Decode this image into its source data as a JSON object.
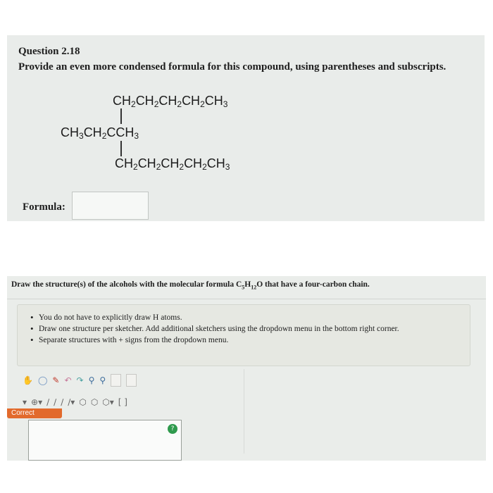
{
  "question": {
    "title": "Question 2.18",
    "prompt": "Provide an even more condensed formula for this compound, using parentheses and subscripts.",
    "structure": {
      "top_chain": [
        "CH",
        "2",
        "CH",
        "2",
        "CH",
        "2",
        "CH",
        "2",
        "CH",
        "3"
      ],
      "middle_chain": [
        "CH",
        "3",
        "CH",
        "2",
        "CCH",
        "3"
      ],
      "bottom_chain": [
        "CH",
        "2",
        "CH",
        "2",
        "CH",
        "2",
        "CH",
        "2",
        "CH",
        "3"
      ]
    },
    "formula_label": "Formula:",
    "formula_value": ""
  },
  "sketcher": {
    "title_parts": [
      "Draw the structure(s) of the alcohols with the molecular formula C",
      "5",
      "H",
      "12",
      "O that have a four-carbon chain."
    ],
    "instructions": [
      "You do not have to explicitly draw H atoms.",
      "Draw one structure per sketcher. Add additional sketchers using the dropdown menu in the bottom right corner.",
      "Separate structures with + signs from the dropdown menu."
    ],
    "correct_label": "Correct",
    "check_symbol": "?"
  }
}
